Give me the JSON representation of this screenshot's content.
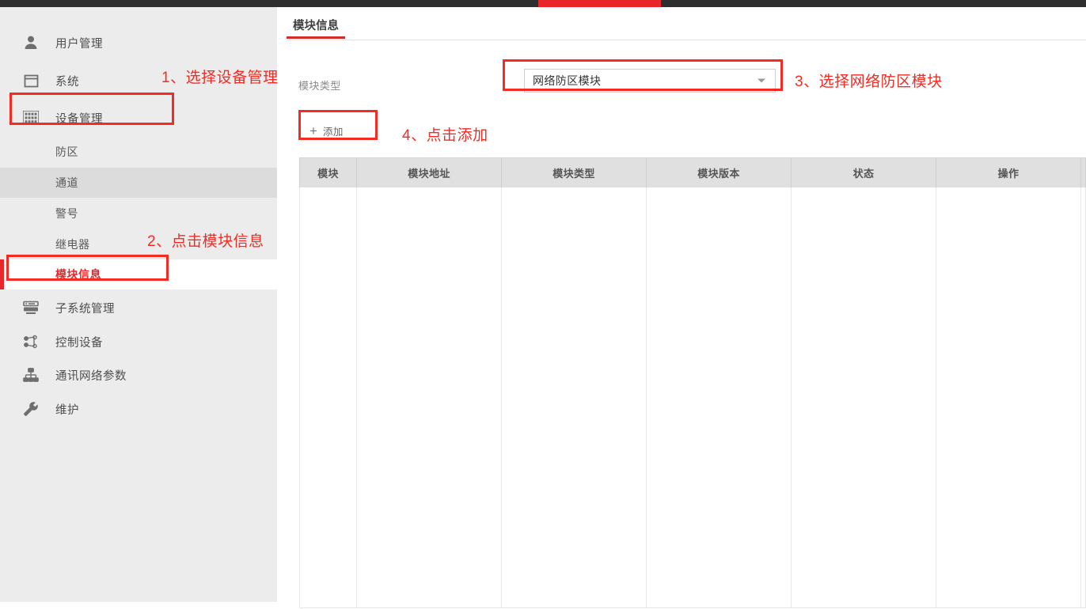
{
  "topbar": {
    "accent_color": "#e8262a",
    "bg_color": "#2e2e2e"
  },
  "sidebar": {
    "top_items": [
      {
        "label": "用户管理",
        "icon": "user-icon"
      },
      {
        "label": "系统",
        "icon": "window-icon"
      },
      {
        "label": "设备管理",
        "icon": "grid-icon"
      },
      {
        "label": "子系统管理",
        "icon": "server-icon"
      },
      {
        "label": "控制设备",
        "icon": "nodes-icon"
      },
      {
        "label": "通讯网络参数",
        "icon": "network-icon"
      },
      {
        "label": "维护",
        "icon": "wrench-icon"
      }
    ],
    "sub_items": [
      {
        "label": "防区",
        "state": "normal"
      },
      {
        "label": "通道",
        "state": "hover"
      },
      {
        "label": "警号",
        "state": "normal"
      },
      {
        "label": "继电器",
        "state": "normal"
      },
      {
        "label": "模块信息",
        "state": "active"
      }
    ]
  },
  "main": {
    "tab": {
      "label": "模块信息"
    },
    "field_label": "模块类型",
    "select": {
      "value": "网络防区模块",
      "options": [
        "网络防区模块"
      ],
      "arrow_icon": "chevron-down-icon"
    },
    "add_button": {
      "label": "添加",
      "icon": "plus-icon"
    },
    "table": {
      "columns": [
        "模块",
        "模块地址",
        "模块类型",
        "模块版本",
        "状态",
        "操作"
      ],
      "rows": []
    }
  },
  "annotations": [
    {
      "id": "1",
      "text": "1、选择设备管理",
      "color": "#f52a22"
    },
    {
      "id": "2",
      "text": "2、点击模块信息",
      "color": "#f52a22"
    },
    {
      "id": "3",
      "text": "3、选择网络防区模块",
      "color": "#f52a22"
    },
    {
      "id": "4",
      "text": "4、点击添加",
      "color": "#f52a22"
    }
  ]
}
